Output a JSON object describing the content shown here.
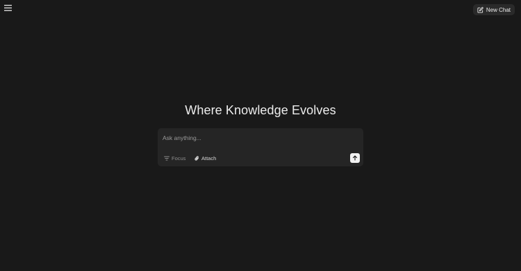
{
  "header": {
    "menu_icon": "hamburger-menu-icon",
    "new_chat": {
      "label": "New Chat",
      "icon": "compose-edit-icon"
    }
  },
  "main": {
    "headline": "Where Knowledge Evolves",
    "composer": {
      "placeholder": "Ask anything...",
      "value": "",
      "focus_label": "Focus",
      "focus_icon": "filter-lines-icon",
      "attach_label": "Attach",
      "attach_icon": "paperclip-icon",
      "send_icon": "arrow-up-icon"
    }
  },
  "colors": {
    "background": "#191919",
    "surface": "#252525",
    "button_surface": "#2a2a2a",
    "send_button": "#f2f2f2"
  }
}
